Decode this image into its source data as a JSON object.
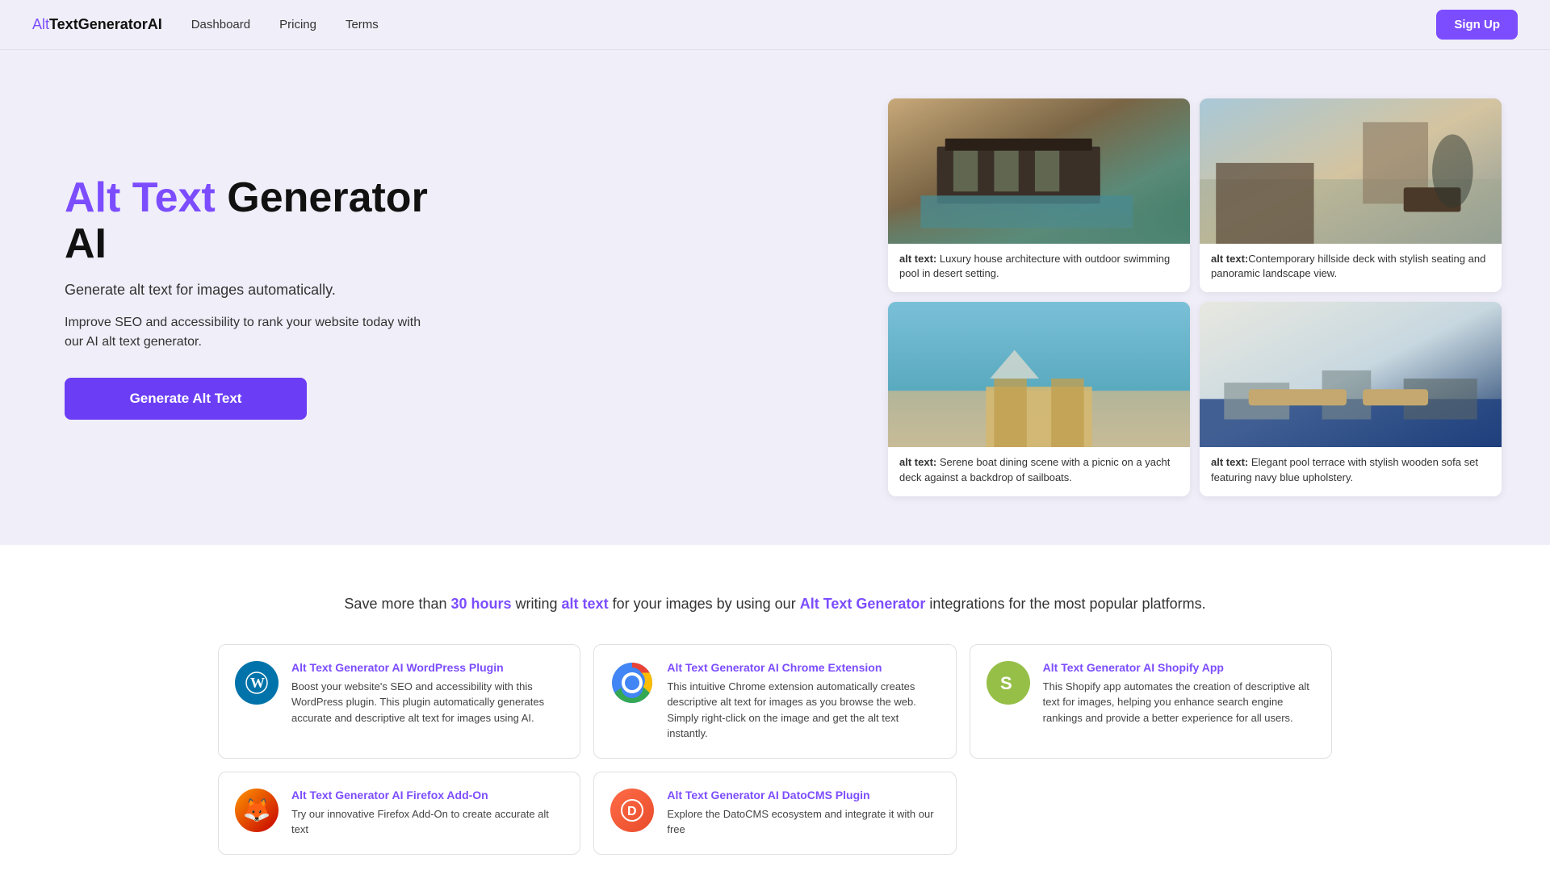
{
  "nav": {
    "logo_alt": "Alt",
    "logo_main": "TextGeneratorAI",
    "links": [
      "Dashboard",
      "Pricing",
      "Terms"
    ],
    "signup_label": "Sign Up"
  },
  "hero": {
    "title_purple": "Alt Text",
    "title_black": " Generator AI",
    "subtitle1": "Generate alt text for images automatically.",
    "subtitle2": "Improve SEO and accessibility to rank your website today with our AI alt text generator.",
    "cta_label": "Generate Alt Text"
  },
  "image_cards": [
    {
      "type": "house-pool",
      "caption_label": "alt text:",
      "caption": " Luxury house architecture with outdoor swimming pool in desert setting."
    },
    {
      "type": "hillside-deck",
      "caption_label": "alt text:",
      "caption": "Contemporary hillside deck with stylish seating and panoramic landscape view."
    },
    {
      "type": "boat-dining",
      "caption_label": "alt text:",
      "caption": " Serene boat dining scene with a picnic on a yacht deck against a backdrop of sailboats."
    },
    {
      "type": "pool-terrace",
      "caption_label": "alt text:",
      "caption": " Elegant pool terrace with stylish wooden sofa set featuring navy blue upholstery."
    }
  ],
  "integrations": {
    "headline_start": "Save more than ",
    "hours": "30 hours",
    "headline_mid": " writing ",
    "alt_text_link": "alt text",
    "headline_mid2": " for your images by using our ",
    "generator_link": "Alt Text Generator",
    "headline_end": " integrations for the most popular platforms."
  },
  "plugins": [
    {
      "id": "wordpress",
      "icon_type": "wp",
      "icon_symbol": "W",
      "title": "Alt Text Generator AI WordPress Plugin",
      "desc": "Boost your website's SEO and accessibility with this WordPress plugin. This plugin automatically generates accurate and descriptive alt text for images using AI."
    },
    {
      "id": "chrome",
      "icon_type": "chrome",
      "icon_symbol": "",
      "title": "Alt Text Generator AI Chrome Extension",
      "desc": "This intuitive Chrome extension automatically creates descriptive alt text for images as you browse the web. Simply right-click on the image and get the alt text instantly."
    },
    {
      "id": "shopify",
      "icon_type": "shopify",
      "icon_symbol": "S",
      "title": "Alt Text Generator AI Shopify App",
      "desc": "This Shopify app automates the creation of descriptive alt text for images, helping you enhance search engine rankings and provide a better experience for all users."
    },
    {
      "id": "firefox",
      "icon_type": "firefox",
      "icon_symbol": "🦊",
      "title": "Alt Text Generator AI Firefox Add-On",
      "desc": "Try our innovative Firefox Add-On to create accurate alt text"
    },
    {
      "id": "datocms",
      "icon_type": "datocms",
      "icon_symbol": "D",
      "title": "Alt Text Generator AI DatoCMS Plugin",
      "desc": "Explore the DatoCMS ecosystem and integrate it with our free"
    }
  ]
}
